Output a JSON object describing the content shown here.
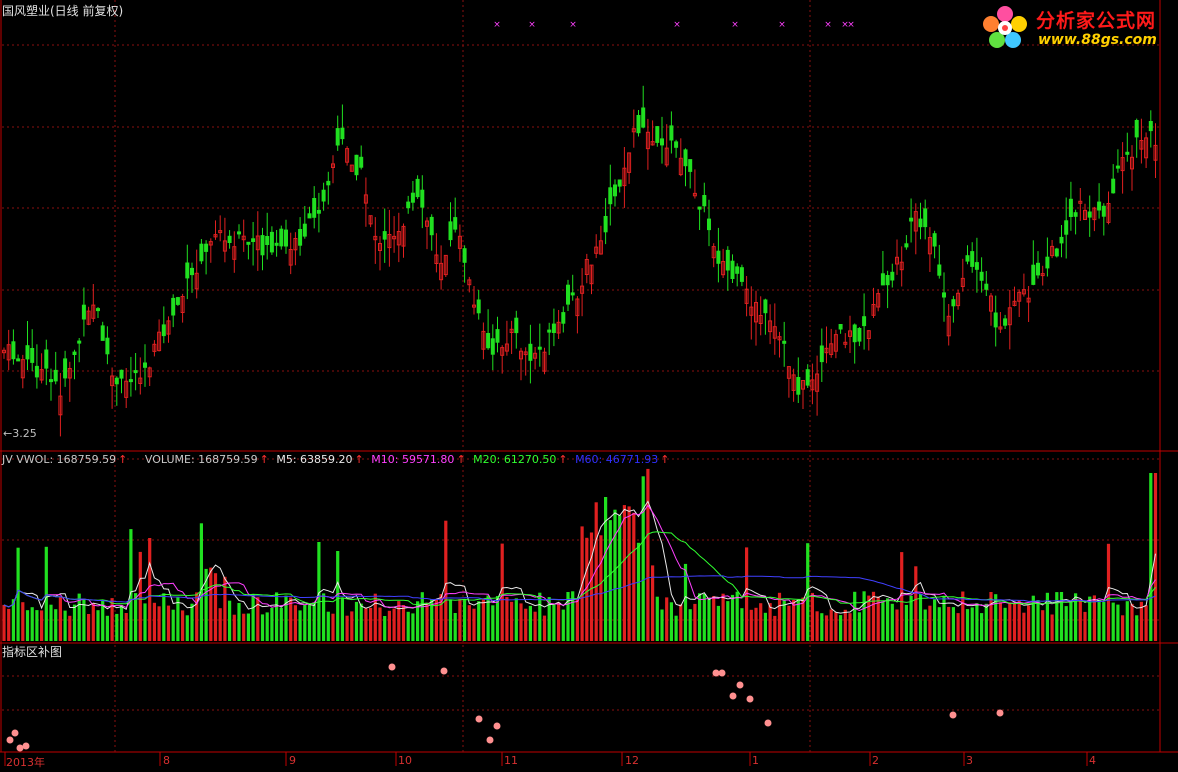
{
  "window": {
    "title": "国风塑业(日线 前复权)"
  },
  "price_panel": {
    "low_marker": "←3.25"
  },
  "volume_panel": {
    "items": [
      {
        "label": "JV VWOL: 168759.59",
        "arrow": "↑",
        "color": "#c8c8c8"
      },
      {
        "label": "VOLUME: 168759.59",
        "arrow": "↑",
        "color": "#c8c8c8"
      },
      {
        "label": "M5: 63859.20",
        "arrow": "↑",
        "color": "#e8e8e8"
      },
      {
        "label": "M10: 59571.80",
        "arrow": "↑",
        "color": "#ff40ff"
      },
      {
        "label": "M20: 61270.50",
        "arrow": "↑",
        "color": "#30ff30"
      },
      {
        "label": "M60: 46771.93",
        "arrow": "↑",
        "color": "#3030ff"
      }
    ]
  },
  "indicator_panel": {
    "title": "指标区补图"
  },
  "x_axis": {
    "months": [
      "2013年",
      "8",
      "9",
      "10",
      "11",
      "12",
      "1",
      "2",
      "3",
      "4"
    ]
  },
  "watermark": {
    "name": "分析家公式网",
    "url": "www.88gs.com"
  },
  "colors": {
    "up": "#e02020",
    "down": "#20e020",
    "grid": "#8a1010",
    "panel_border": "#c00000",
    "marker": "#ff40ff",
    "dot": "#ff9090"
  }
}
